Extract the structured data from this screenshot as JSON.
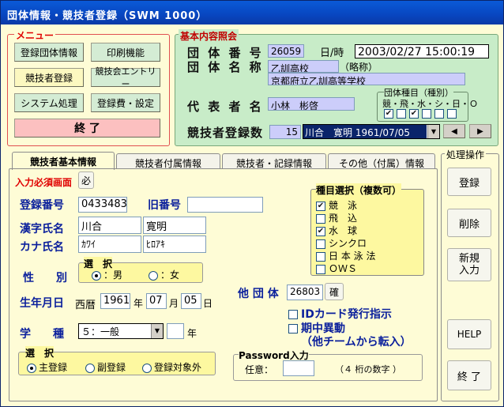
{
  "window": {
    "title": "団体情報・競技者登録（SWM 1000）"
  },
  "menu": {
    "label": "メニュー",
    "btn_register_group": "登録団体情報",
    "btn_print": "印刷機能",
    "btn_athlete": "競技者登録",
    "btn_meet_entry": "競技会エントリー",
    "btn_system": "システム処理",
    "btn_fee": "登録費・設定",
    "btn_exit": "終 了"
  },
  "info": {
    "label": "基本内容照会",
    "group_no_label": "団 体 番 号",
    "group_no": "26059",
    "datetime_label": "日/時",
    "datetime": "2003/02/27 15:00:19",
    "group_name_label": "団 体 名 称",
    "group_short": "乙訓高校",
    "short_label": "（略称）",
    "group_full": "京都府立乙訓高等学校",
    "rep_label": "代 表 者 名",
    "rep_name": "小林　彬啓",
    "kind_label": "団体種目（種別）",
    "kind_cols": "競・飛・水・シ・日・Ｏ",
    "kind_checks": [
      "✔",
      "",
      "✔",
      "",
      "",
      ""
    ],
    "count_label": "競技者登録数",
    "count": "15",
    "athlete_select": "川合　寛明 1961/07/05"
  },
  "tabs": [
    "競技者基本情報",
    "競技者付属情報",
    "競技者・記録情報",
    "その他（付属）情報"
  ],
  "form": {
    "required_label": "入力必須画面",
    "required_btn": "必",
    "reg_no_label": "登録番号",
    "reg_no": "0433483",
    "old_no_label": "旧番号",
    "old_no": "",
    "kanji_label": "漢字氏名",
    "kanji_last": "川合",
    "kanji_first": "寛明",
    "kana_label": "カナ氏名",
    "kana_last": "ｶﾜｲ",
    "kana_first": "ﾋﾛｱｷ",
    "select_label": "選　択",
    "male": "：男",
    "female": "：女",
    "gender_label": "性　　別",
    "birth_label": "生年月日",
    "era": "西暦",
    "year": "1961",
    "year_unit": "年",
    "month": "07",
    "month_unit": "月",
    "day": "05",
    "day_unit": "日",
    "grade_label": "学　　種",
    "grade": "５：一般",
    "grade_suffix": "年",
    "reg_label": "選　択",
    "reg_main": "主登録",
    "reg_sub": "副登録",
    "reg_excluded": "登録対象外",
    "event_label": "種目選択（複数可）",
    "events": [
      {
        "name": "競　泳",
        "checked": true
      },
      {
        "name": "飛　込",
        "checked": false
      },
      {
        "name": "水　球",
        "checked": true
      },
      {
        "name": "シンクロ",
        "checked": false
      },
      {
        "name": "日 本 泳 法",
        "checked": false
      },
      {
        "name": "ＯＷＳ",
        "checked": false
      }
    ],
    "other_group_label": "他 団 体",
    "other_group": "26803",
    "other_group_btn": "確",
    "idcard": "IDカード発行指示",
    "transfer1": "期中異動",
    "transfer2": "（他チームから転入）",
    "pw_label": "Password入力",
    "pw_any": "任意：",
    "pw_hint": "（４ 桁の数字 ）"
  },
  "ops": {
    "label": "処理操作",
    "register": "登録",
    "delete": "削除",
    "new1": "新規",
    "new2": "入力",
    "help": "HELP",
    "exit": "終 了"
  }
}
